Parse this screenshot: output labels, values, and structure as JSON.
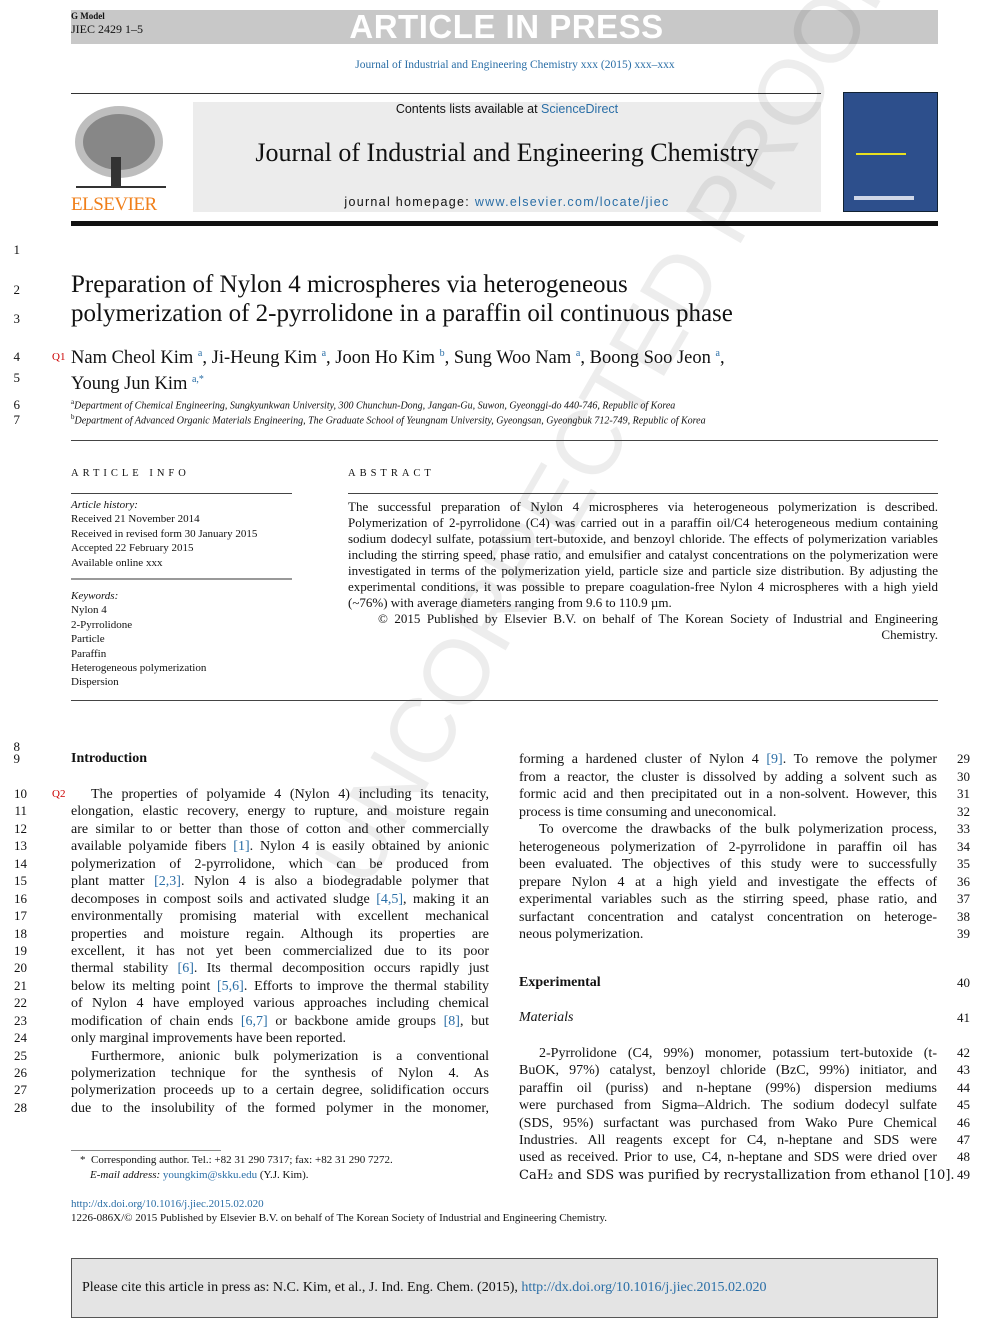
{
  "header": {
    "g_model": "G Model",
    "ref_code": "JIEC 2429 1–5",
    "banner": "ARTICLE IN PRESS",
    "journal_ref": "Journal of Industrial and Engineering Chemistry xxx (2015) xxx–xxx",
    "contents_prefix": "Contents lists available at ",
    "sciencedirect": "ScienceDirect",
    "journal_title": "Journal of Industrial and Engineering Chemistry",
    "homepage_prefix": "journal homepage: ",
    "homepage_url": "www.elsevier.com/locate/jiec",
    "publisher_logo": "ELSEVIER"
  },
  "watermark": "UNCORRECTED PROOF",
  "title_lines": [
    "Preparation of Nylon 4 microspheres via heterogeneous",
    "polymerization of 2-pyrrolidone in a paraffin oil continuous phase"
  ],
  "query_marks": [
    "Q1",
    "Q2"
  ],
  "authors": [
    {
      "name": "Nam Cheol Kim",
      "aff": "a"
    },
    {
      "name": "Ji-Heung Kim",
      "aff": "a"
    },
    {
      "name": "Joon Ho Kim",
      "aff": "b"
    },
    {
      "name": "Sung Woo Nam",
      "aff": "a"
    },
    {
      "name": "Boong Soo Jeon",
      "aff": "a"
    },
    {
      "name": "Young Jun Kim",
      "aff": "a,*"
    }
  ],
  "affiliations": [
    {
      "mark": "a",
      "text": "Department of Chemical Engineering, Sungkyunkwan University, 300 Chunchun-Dong, Jangan-Gu, Suwon, Gyeonggi-do 440-746, Republic of Korea"
    },
    {
      "mark": "b",
      "text": "Department of Advanced Organic Materials Engineering, The Graduate School of Yeungnam University, Gyeongsan, Gyeongbuk 712-749, Republic of Korea"
    }
  ],
  "article_info": {
    "heading": "ARTICLE INFO",
    "history_label": "Article history:",
    "history": [
      "Received 21 November 2014",
      "Received in revised form 30 January 2015",
      "Accepted 22 February 2015",
      "Available online xxx"
    ],
    "keywords_label": "Keywords:",
    "keywords": [
      "Nylon 4",
      "2-Pyrrolidone",
      "Particle",
      "Paraffin",
      "Heterogeneous polymerization",
      "Dispersion"
    ]
  },
  "abstract": {
    "heading": "ABSTRACT",
    "text": "The successful preparation of Nylon 4 microspheres via heterogeneous polymerization is described. Polymerization of 2-pyrrolidone (C4) was carried out in a paraffin oil/C4 heterogeneous medium containing sodium dodecyl sulfate, potassium tert-butoxide, and benzoyl chloride. The effects of polymerization variables including the stirring speed, phase ratio, and emulsifier and catalyst concentrations on the polymerization were investigated in terms of the polymerization yield, particle size and particle size distribution. By adjusting the experimental conditions, it was possible to prepare coagulation-free Nylon 4 microspheres with a high yield (~76%) with average diameters ranging from 9.6 to 110.9 µm.",
    "copyright": "© 2015 Published by Elsevier B.V. on behalf of The Korean Society of Industrial and Engineering Chemistry."
  },
  "line_numbers": {
    "pre": [
      "1",
      "2",
      "3",
      "4",
      "5",
      "6",
      "7",
      "8"
    ]
  },
  "intro": {
    "heading": "Introduction",
    "heading_num": "9",
    "lines": [
      "The properties of polyamide 4 (Nylon 4) including its tenacity,",
      "elongation, elastic recovery, energy to rupture, and moisture regain",
      "are similar to or better than those of cotton and other commercially",
      "available polyamide fibers [1]. Nylon 4 is easily obtained by anionic",
      "polymerization of 2-pyrrolidone, which can be produced from",
      "plant matter [2,3]. Nylon 4 is also a biodegradable polymer that",
      "decomposes in compost soils and activated sludge [4,5], making it an",
      "environmentally promising material with excellent mechanical",
      "properties and moisture regain. Although its properties are",
      "excellent, it has not yet been commercialized due to its poor",
      "thermal stability [6]. Its thermal decomposition occurs rapidly just",
      "below its melting point [5,6]. Efforts to improve the thermal stability",
      "of Nylon 4 have employed various approaches including chemical",
      "modification of chain ends [6,7] or backbone amide groups [8], but",
      "only marginal improvements have been reported.",
      "Furthermore, anionic bulk polymerization is a conventional",
      "polymerization technique for the synthesis of Nylon 4. As",
      "polymerization proceeds up to a certain degree, solidification occurs",
      "due to the insolubility of the formed polymer in the monomer,",
      "forming a hardened cluster of Nylon 4 [9]. To remove the polymer",
      "from a reactor, the cluster is dissolved by adding a solvent such as",
      "formic acid and then precipitated out in a non-solvent. However, this",
      "process is time consuming and uneconomical.",
      "To overcome the drawbacks of the bulk polymerization process,",
      "heterogeneous polymerization of 2-pyrrolidone in paraffin oil has",
      "been evaluated. The objectives of this study were to successfully",
      "prepare Nylon 4 at a high yield and investigate the effects of",
      "experimental variables such as the stirring speed, phase ratio, and",
      "surfactant concentration and catalyst concentration on heteroge-",
      "neous polymerization."
    ]
  },
  "experimental": {
    "heading": "Experimental",
    "heading_num": "40",
    "sub": "Materials",
    "sub_num": "41",
    "lines": [
      "2-Pyrrolidone (C4, 99%) monomer, potassium tert-butoxide (t-",
      "BuOK, 97%) catalyst, benzoyl chloride (BzC, 99%) initiator, and",
      "paraffin oil (puriss) and n-heptane (99%) dispersion mediums",
      "were purchased from Sigma–Aldrich. The sodium dodecyl sulfate",
      "(SDS, 95%) surfactant was purchased from Wako Pure Chemical",
      "Industries. All reagents except for C4, n-heptane and SDS were",
      "used as received. Prior to use, C4, n-heptane and SDS were dried over",
      "CaH₂ and SDS was purified by recrystallization from ethanol [10]."
    ]
  },
  "footnote": {
    "mark": "*",
    "corr": "Corresponding author. Tel.: +82 31 290 7317; fax: +82 31 290 7272.",
    "email_label": "E-mail address: ",
    "email": "youngkim@skku.edu",
    "email_suffix": " (Y.J. Kim)."
  },
  "doi": "http://dx.doi.org/10.1016/j.jiec.2015.02.020",
  "issn_line": "1226-086X/© 2015 Published by Elsevier B.V. on behalf of The Korean Society of Industrial and Engineering Chemistry.",
  "cite_box": {
    "prefix": "Please cite this article in press as: N.C. Kim, et al., J. Ind. Eng. Chem. (2015), ",
    "link": "http://dx.doi.org/10.1016/j.jiec.2015.02.020"
  }
}
